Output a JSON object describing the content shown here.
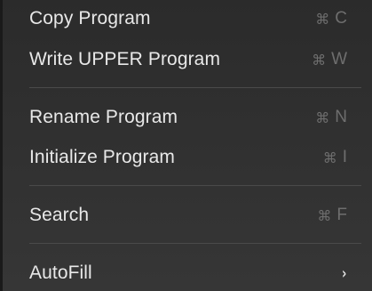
{
  "menu": {
    "items": [
      {
        "label": "Copy Program",
        "key": "C"
      },
      {
        "label": "Write UPPER Program",
        "key": "W"
      },
      {
        "label": "Rename Program",
        "key": "N"
      },
      {
        "label": "Initialize Program",
        "key": "I"
      },
      {
        "label": "Search",
        "key": "F"
      },
      {
        "label": "AutoFill",
        "submenu_indicator": "›"
      }
    ],
    "shortcut_modifier": "⌘"
  },
  "colors": {
    "background": "#2e2e2e",
    "label": "#e8e8e8",
    "shortcut": "#6e6e6e",
    "separator": "#4a4a4a"
  }
}
